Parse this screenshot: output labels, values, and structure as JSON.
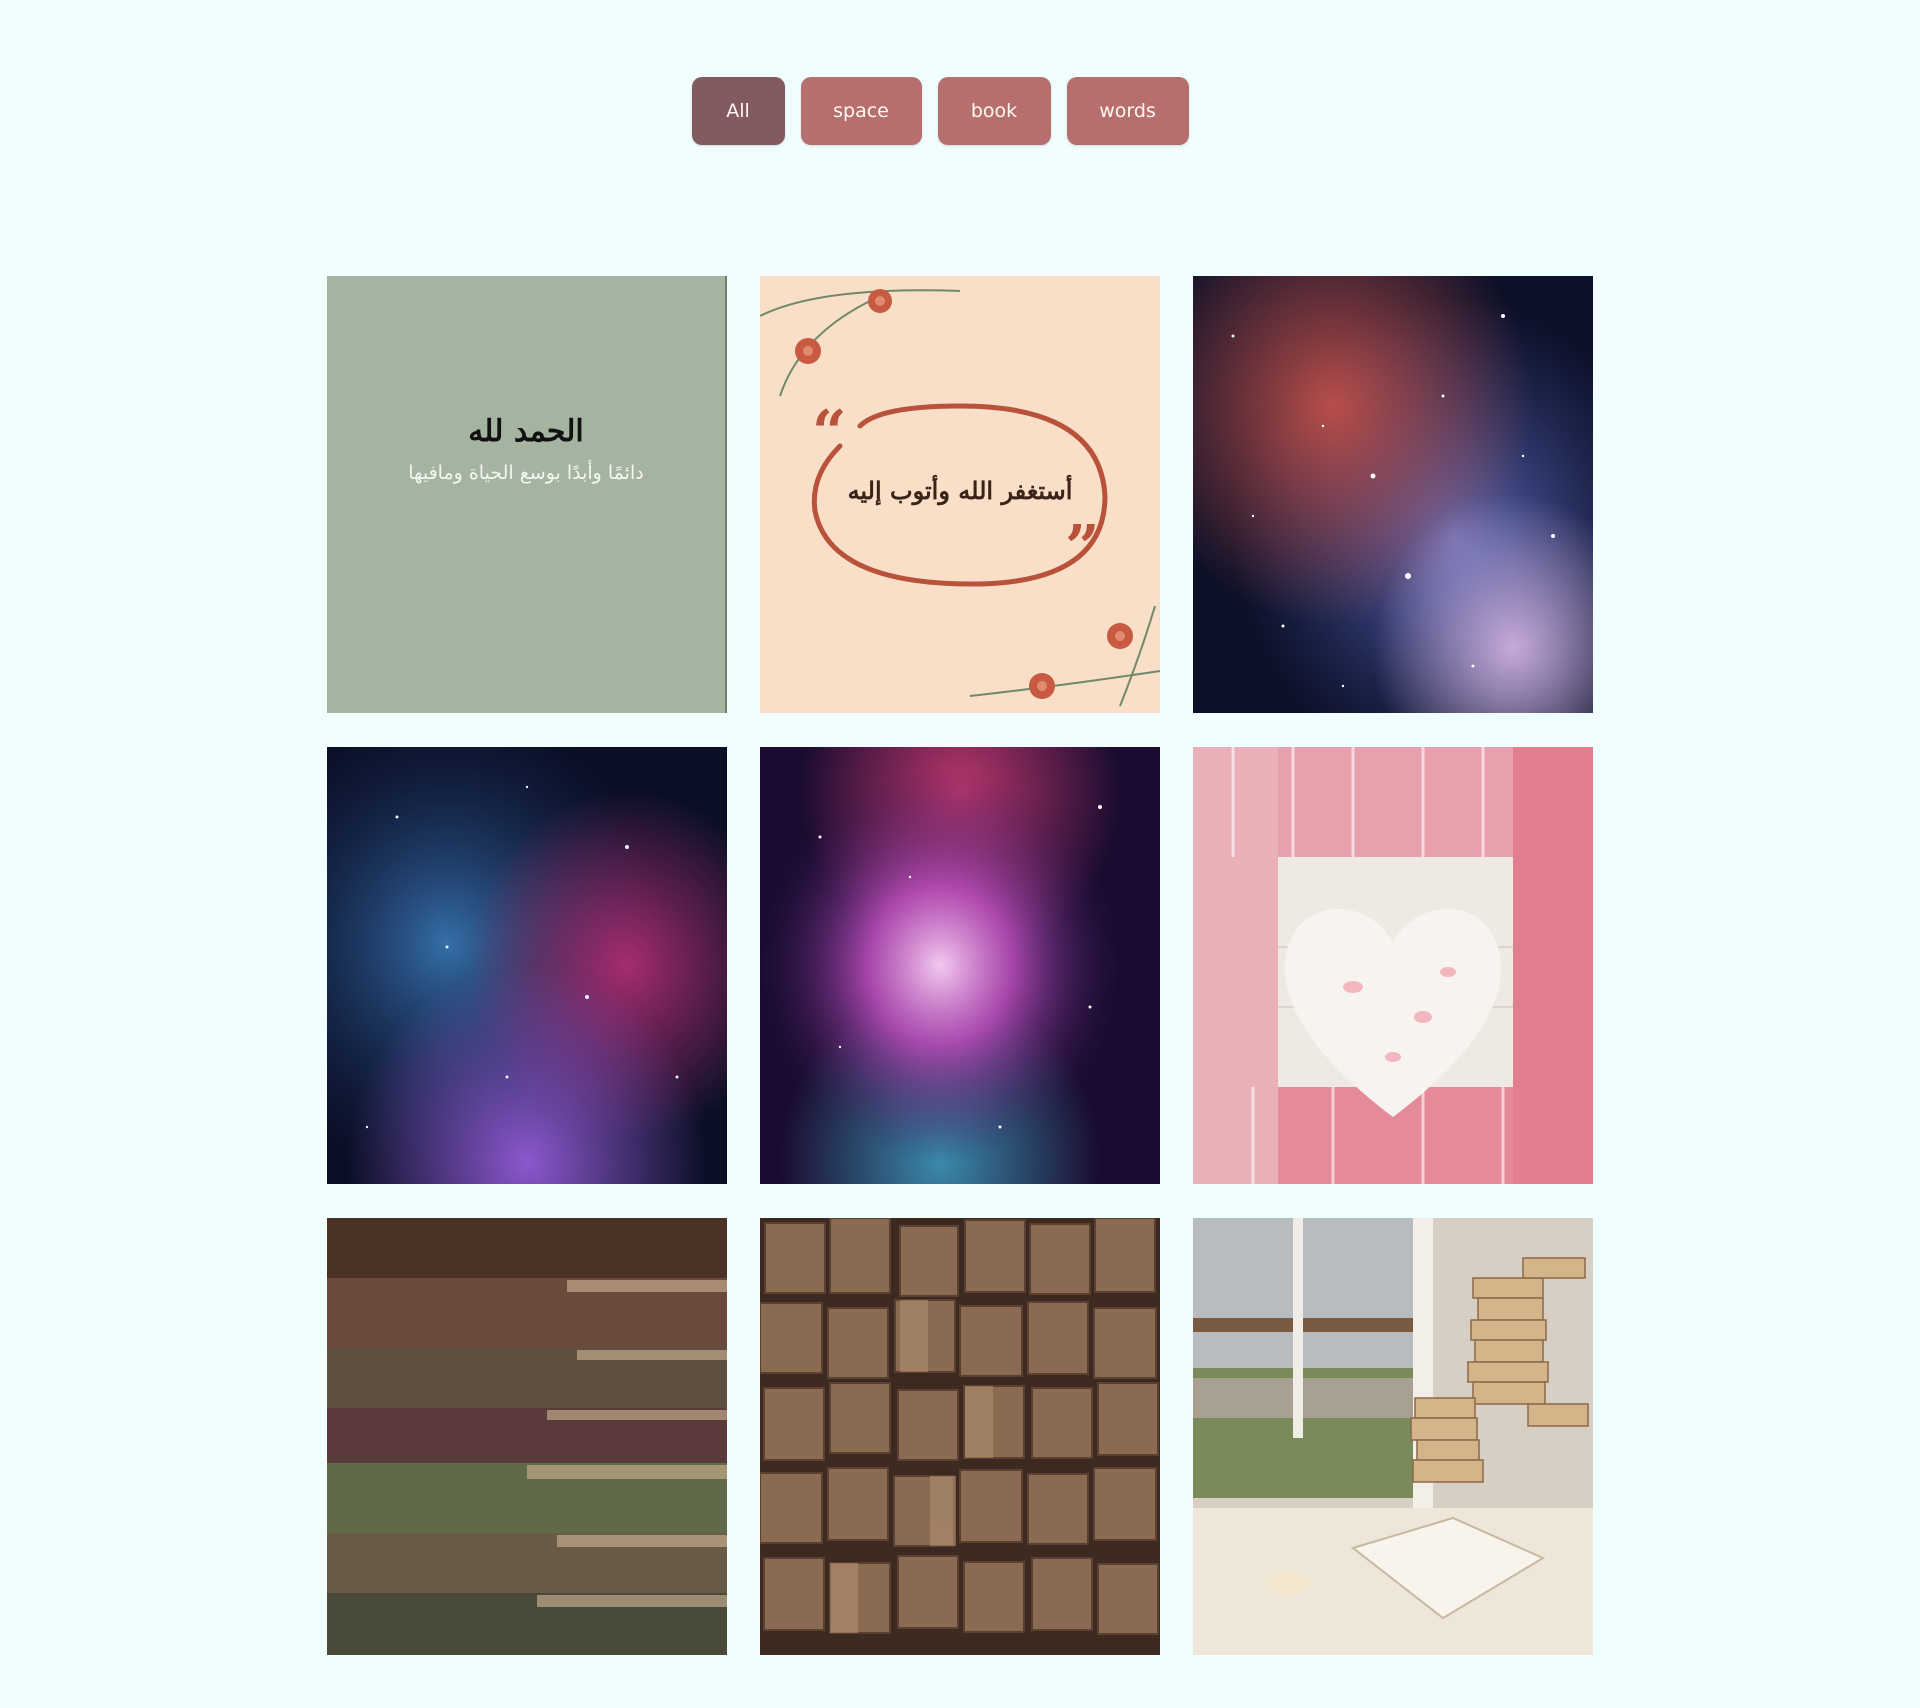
{
  "filters": [
    {
      "label": "All",
      "active": true
    },
    {
      "label": "space",
      "active": false
    },
    {
      "label": "book",
      "active": false
    },
    {
      "label": "words",
      "active": false
    }
  ],
  "gallery": {
    "items": [
      {
        "category": "words",
        "title": "الحمد لله",
        "subtitle": "دائمًا وأبدًا بوسع الحياة ومافيها"
      },
      {
        "category": "words",
        "text": "أستغفر الله وأتوب إليه"
      },
      {
        "category": "space"
      },
      {
        "category": "space"
      },
      {
        "category": "space"
      },
      {
        "category": "book"
      },
      {
        "category": "book"
      },
      {
        "category": "book"
      },
      {
        "category": "book"
      }
    ]
  },
  "colors": {
    "page_bg": "#f0fffe",
    "button": "#b76e6e",
    "button_active": "#835a5e",
    "button_text": "#fff8f0"
  }
}
